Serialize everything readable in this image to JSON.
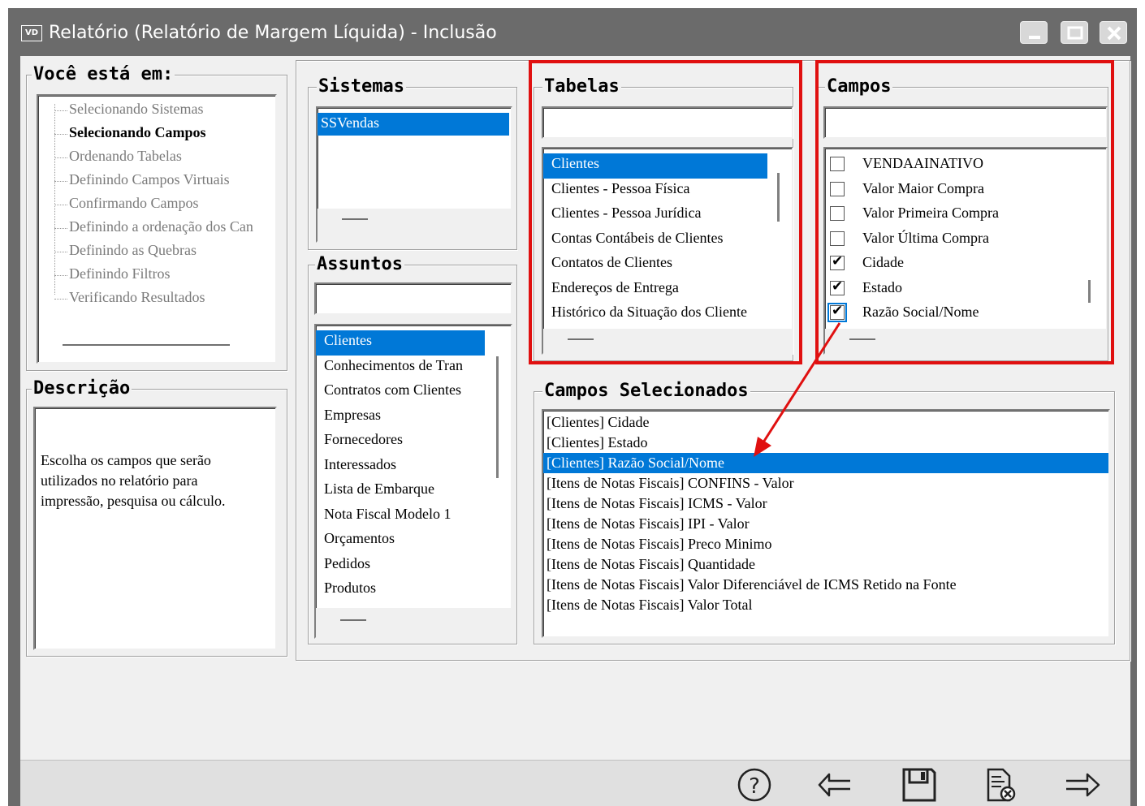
{
  "window": {
    "icon_label": "VD",
    "title": "Relatório (Relatório de Margem Líquida) - Inclusão"
  },
  "nav": {
    "heading": "Você está em:",
    "steps": [
      {
        "label": "Selecionando Sistemas",
        "active": false
      },
      {
        "label": "Selecionando Campos",
        "active": true
      },
      {
        "label": "Ordenando Tabelas",
        "active": false
      },
      {
        "label": "Definindo Campos Virtuais",
        "active": false
      },
      {
        "label": "Confirmando Campos",
        "active": false
      },
      {
        "label": "Definindo a ordenação dos Can",
        "active": false
      },
      {
        "label": "Definindo as Quebras",
        "active": false
      },
      {
        "label": "Definindo Filtros",
        "active": false
      },
      {
        "label": "Verificando Resultados",
        "active": false
      }
    ]
  },
  "descricao": {
    "heading": "Descrição",
    "lines": [
      "Escolha os campos que serão",
      "utilizados no relatório para",
      "impressão, pesquisa ou cálculo."
    ]
  },
  "sistemas": {
    "heading": "Sistemas",
    "items": [
      "SSVendas"
    ],
    "selected": 0
  },
  "assuntos": {
    "heading": "Assuntos",
    "search_value": "",
    "items": [
      "Clientes",
      "Conhecimentos de Tran",
      "Contratos com Clientes",
      "Empresas",
      "Fornecedores",
      "Interessados",
      "Lista de Embarque",
      "Nota Fiscal Modelo 1",
      "Orçamentos",
      "Pedidos",
      "Produtos"
    ],
    "selected": 0
  },
  "tabelas": {
    "heading": "Tabelas",
    "search_value": "",
    "items": [
      "Clientes",
      "Clientes - Pessoa Física",
      "Clientes - Pessoa Jurídica",
      "Contas Contábeis de Clientes",
      "Contatos de Clientes",
      "Endereços de Entrega",
      "Histórico da Situação dos Cliente"
    ],
    "selected": 0
  },
  "campos": {
    "heading": "Campos",
    "search_value": "",
    "items": [
      {
        "label": "VENDAAINATIVO",
        "checked": false
      },
      {
        "label": "Valor Maior Compra",
        "checked": false
      },
      {
        "label": "Valor Primeira Compra",
        "checked": false
      },
      {
        "label": "Valor Última Compra",
        "checked": false
      },
      {
        "label": "Cidade",
        "checked": true
      },
      {
        "label": "Estado",
        "checked": true
      },
      {
        "label": "Razão Social/Nome",
        "checked": true
      }
    ]
  },
  "selecionados": {
    "heading": "Campos Selecionados",
    "items": [
      "[Clientes] Cidade",
      "[Clientes] Estado",
      "[Clientes] Razão Social/Nome",
      "[Itens de Notas Fiscais] CONFINS - Valor",
      "[Itens de Notas Fiscais] ICMS - Valor",
      "[Itens de Notas Fiscais] IPI - Valor",
      "[Itens de Notas Fiscais] Preco Minimo",
      "[Itens de Notas Fiscais] Quantidade",
      "[Itens de Notas Fiscais] Valor Diferenciável de ICMS Retido na Fonte",
      "[Itens de Notas Fiscais] Valor Total"
    ],
    "selected": 2
  },
  "toolbar": {
    "help": "help-icon",
    "back": "arrow-left-icon",
    "save": "save-icon",
    "cancel": "cancel-document-icon",
    "next": "arrow-right-icon"
  },
  "colors": {
    "selection": "#0078d7",
    "highlight": "#e01010",
    "titlebar": "#6b6b6b"
  }
}
